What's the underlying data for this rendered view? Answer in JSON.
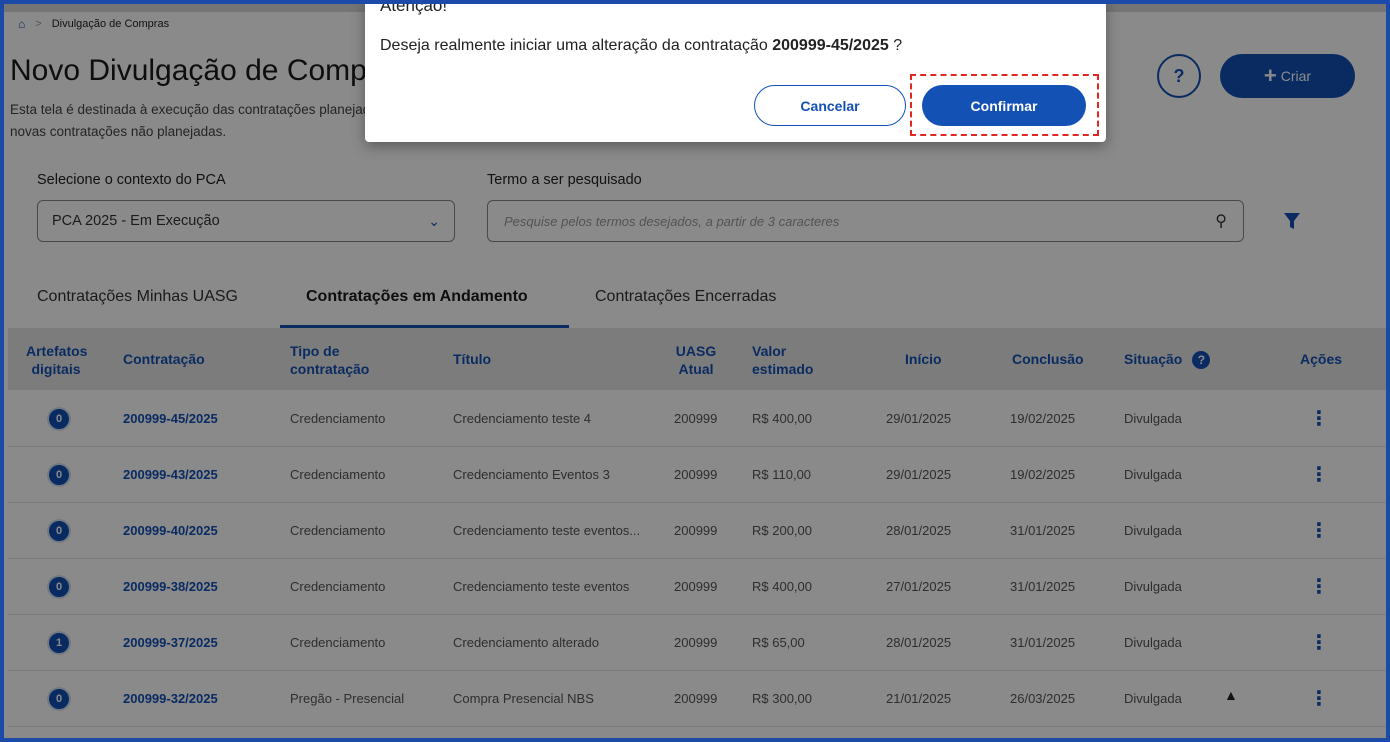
{
  "breadcrumb": {
    "home_icon": "home-icon",
    "current": "Divulgação de Compras"
  },
  "header": {
    "title": "Novo Divulgação de Compras",
    "description": "Esta tela é destinada à execução das contratações planejadas e novas contratações não planejadas.",
    "help_label": "?",
    "create_label": "Criar"
  },
  "filters": {
    "context_label": "Selecione o contexto do PCA",
    "context_value": "PCA 2025 - Em Execução",
    "search_label": "Termo a ser pesquisado",
    "search_placeholder": "Pesquise pelos termos desejados, a partir de 3 caracteres"
  },
  "tabs": [
    {
      "label": "Contratações Minhas UASG",
      "active": false
    },
    {
      "label": "Contratações em Andamento",
      "active": true
    },
    {
      "label": "Contratações Encerradas",
      "active": false
    }
  ],
  "table": {
    "headers": {
      "artefatos": "Artefatos digitais",
      "contratacao": "Contratação",
      "tipo": "Tipo de contratação",
      "titulo": "Título",
      "uasg": "UASG Atual",
      "valor": "Valor estimado",
      "inicio": "Início",
      "conclusao": "Conclusão",
      "situacao": "Situação",
      "acoes": "Ações"
    },
    "rows": [
      {
        "artefatos": "0",
        "contratacao": "200999-45/2025",
        "tipo": "Credenciamento",
        "titulo": "Credenciamento teste 4",
        "uasg": "200999",
        "valor": "R$ 400,00",
        "inicio": "29/01/2025",
        "conclusao": "19/02/2025",
        "situacao": "Divulgada",
        "warning": false
      },
      {
        "artefatos": "0",
        "contratacao": "200999-43/2025",
        "tipo": "Credenciamento",
        "titulo": "Credenciamento Eventos 3",
        "uasg": "200999",
        "valor": "R$ 110,00",
        "inicio": "29/01/2025",
        "conclusao": "19/02/2025",
        "situacao": "Divulgada",
        "warning": false
      },
      {
        "artefatos": "0",
        "contratacao": "200999-40/2025",
        "tipo": "Credenciamento",
        "titulo": "Credenciamento teste eventos...",
        "uasg": "200999",
        "valor": "R$ 200,00",
        "inicio": "28/01/2025",
        "conclusao": "31/01/2025",
        "situacao": "Divulgada",
        "warning": false
      },
      {
        "artefatos": "0",
        "contratacao": "200999-38/2025",
        "tipo": "Credenciamento",
        "titulo": "Credenciamento teste eventos",
        "uasg": "200999",
        "valor": "R$ 400,00",
        "inicio": "27/01/2025",
        "conclusao": "31/01/2025",
        "situacao": "Divulgada",
        "warning": false
      },
      {
        "artefatos": "1",
        "contratacao": "200999-37/2025",
        "tipo": "Credenciamento",
        "titulo": "Credenciamento alterado",
        "uasg": "200999",
        "valor": "R$ 65,00",
        "inicio": "28/01/2025",
        "conclusao": "31/01/2025",
        "situacao": "Divulgada",
        "warning": false
      },
      {
        "artefatos": "0",
        "contratacao": "200999-32/2025",
        "tipo": "Pregão - Presencial",
        "titulo": "Compra Presencial NBS",
        "uasg": "200999",
        "valor": "R$ 300,00",
        "inicio": "21/01/2025",
        "conclusao": "26/03/2025",
        "situacao": "Divulgada",
        "warning": true
      }
    ]
  },
  "modal": {
    "title": "Atenção!",
    "message_prefix": "Deseja realmente iniciar uma alteração da contratação ",
    "message_id": "200999-45/2025",
    "message_suffix": " ?",
    "cancel_label": "Cancelar",
    "confirm_label": "Confirmar",
    "highlight_color": "#e0281e"
  },
  "colors": {
    "primary": "#1351b4",
    "frame": "#1c4aa8"
  }
}
